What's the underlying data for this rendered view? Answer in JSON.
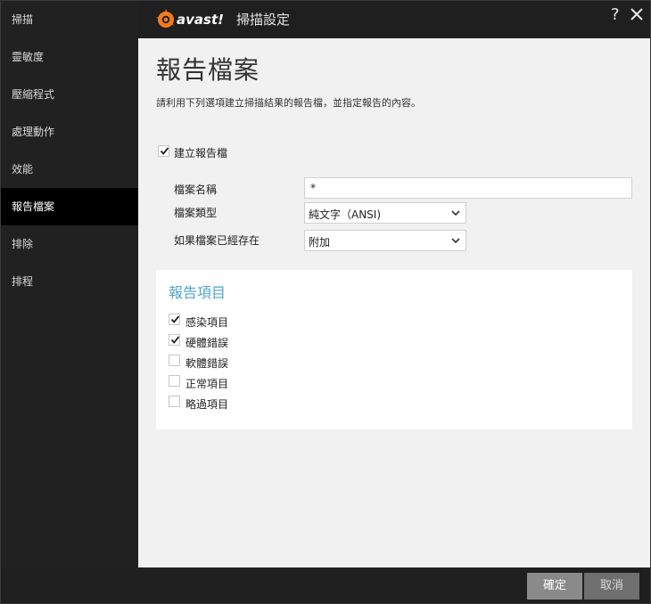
{
  "window": {
    "title": "掃描設定",
    "help_label": "?"
  },
  "brand": {
    "logo_text": "avast!",
    "accent": "#f47a20"
  },
  "sidebar": {
    "items": [
      {
        "label": "掃描",
        "active": false
      },
      {
        "label": "靈敏度",
        "active": false
      },
      {
        "label": "壓縮程式",
        "active": false
      },
      {
        "label": "處理動作",
        "active": false
      },
      {
        "label": "效能",
        "active": false
      },
      {
        "label": "報告檔案",
        "active": true
      },
      {
        "label": "排除",
        "active": false
      },
      {
        "label": "排程",
        "active": false
      }
    ]
  },
  "main": {
    "title": "報告檔案",
    "description": "請利用下列選項建立掃描結果的報告檔，並指定報告的內容。",
    "create_report": {
      "label": "建立報告檔",
      "checked": true
    },
    "fields": {
      "file_name": {
        "label": "檔案名稱",
        "value": "*"
      },
      "file_type": {
        "label": "檔案類型",
        "value": "純文字（ANSI)"
      },
      "if_exists": {
        "label": "如果檔案已經存在",
        "value": "附加"
      }
    },
    "report_items": {
      "title": "報告項目",
      "items": [
        {
          "label": "感染項目",
          "checked": true
        },
        {
          "label": "硬體錯誤",
          "checked": true
        },
        {
          "label": "軟體錯誤",
          "checked": false
        },
        {
          "label": "正常項目",
          "checked": false
        },
        {
          "label": "略過項目",
          "checked": false
        }
      ]
    }
  },
  "footer": {
    "ok_label": "確定",
    "cancel_label": "取消"
  },
  "colors": {
    "panel_title": "#4fa6c8",
    "sidebar_active": "#000000",
    "sidebar_bg": "#212121"
  }
}
